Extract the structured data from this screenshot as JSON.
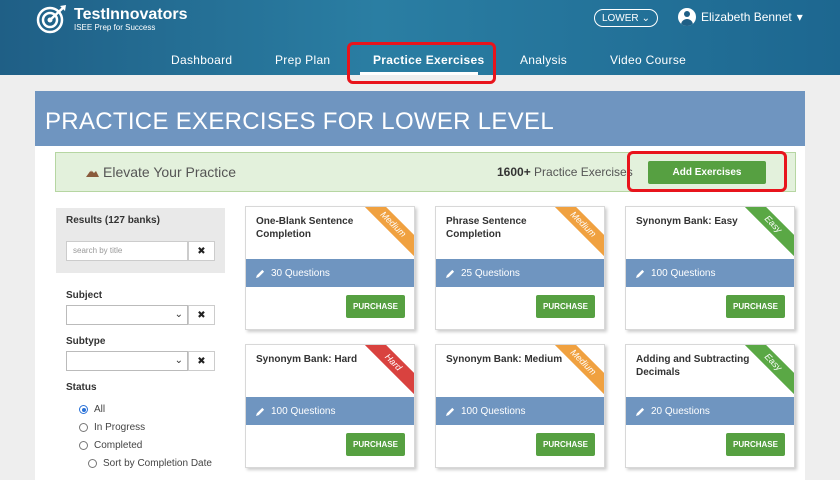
{
  "brand": {
    "name": "TestInnovators",
    "tagline": "ISEE Prep for Success"
  },
  "header": {
    "level_button": "LOWER",
    "user_name": "Elizabeth Bennet",
    "nav": [
      {
        "label": "Dashboard"
      },
      {
        "label": "Prep Plan"
      },
      {
        "label": "Practice Exercises"
      },
      {
        "label": "Analysis"
      },
      {
        "label": "Video Course"
      }
    ],
    "active_nav": "Practice Exercises"
  },
  "page": {
    "title": "PRACTICE EXERCISES FOR LOWER LEVEL"
  },
  "elevate": {
    "label": "Elevate Your Practice",
    "count": "1600+",
    "count_suffix": " Practice Exercises",
    "add_button": "Add Exercises"
  },
  "sidebar": {
    "results": "Results (127 banks)",
    "search_placeholder": "search by title",
    "subject_label": "Subject",
    "subtype_label": "Subtype",
    "status_label": "Status",
    "status_options": [
      "All",
      "In Progress",
      "Completed"
    ],
    "status_selected": "All",
    "sort_option": "Sort by Completion Date"
  },
  "cards": [
    {
      "title": "One-Blank Sentence Completion",
      "questions": "30 Questions",
      "difficulty": "Medium",
      "button": "PURCHASE"
    },
    {
      "title": "Phrase Sentence Completion",
      "questions": "25 Questions",
      "difficulty": "Medium",
      "button": "PURCHASE"
    },
    {
      "title": "Synonym Bank: Easy",
      "questions": "100 Questions",
      "difficulty": "Easy",
      "button": "PURCHASE"
    },
    {
      "title": "Synonym Bank: Hard",
      "questions": "100 Questions",
      "difficulty": "Hard",
      "button": "PURCHASE"
    },
    {
      "title": "Synonym Bank: Medium",
      "questions": "100 Questions",
      "difficulty": "Medium",
      "button": "PURCHASE"
    },
    {
      "title": "Adding and Subtracting Decimals",
      "questions": "20 Questions",
      "difficulty": "Easy",
      "button": "PURCHASE"
    }
  ],
  "colors": {
    "header": "#1f5f86",
    "accent_blue": "#6f95c0",
    "button_green": "#56a041",
    "highlight_red": "#e8141c",
    "difficulty_medium": "#f0a140",
    "difficulty_easy": "#5aa845",
    "difficulty_hard": "#d9423f"
  }
}
